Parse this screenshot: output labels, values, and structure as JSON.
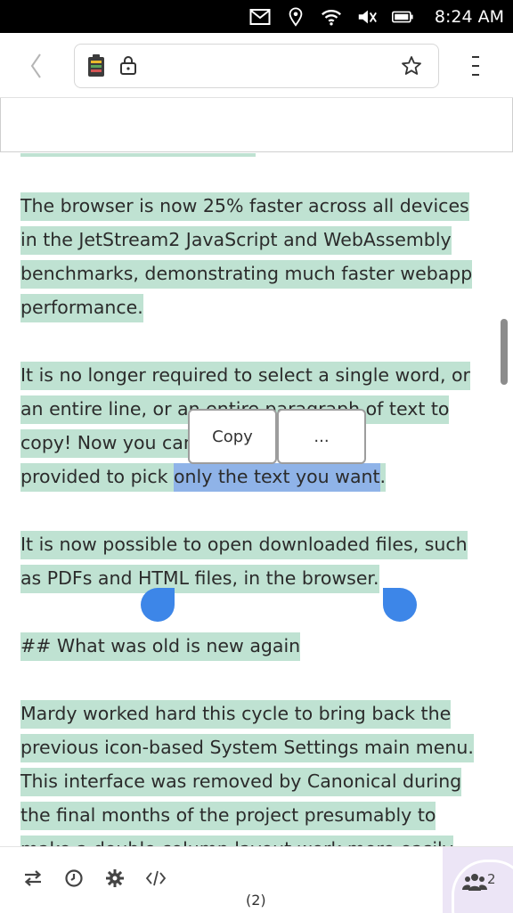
{
  "status": {
    "time": "8:24 AM",
    "icons": [
      "mail-icon",
      "location-icon",
      "wifi-icon",
      "volume-muted-icon",
      "battery-icon"
    ]
  },
  "header": {
    "back_icon": "chevron-left-icon",
    "site_icon": "app-icon",
    "lock_icon": "lock-icon",
    "bookmark_icon": "star-icon",
    "menu_icon": "kebab-menu-icon"
  },
  "content": {
    "paragraph1": "The browser is now 25% faster across all devices in the JetStream2 JavaScript and WebAssembly benchmarks, demonstrating much faster webapp performance.",
    "paragraph2_line1": "It is no longer required to select a single word, or",
    "paragraph2_line2": "an entire line, or an entire paragraph of text to",
    "paragraph2_line3": "copy! Now you can use the handles",
    "paragraph2_line4_plain": "provided to pick ",
    "paragraph2_line4_selected": "only the text you want",
    "paragraph2_line4_end": ".",
    "paragraph3": "It is now possible to open downloaded files, such as PDFs and HTML files, in the browser.",
    "heading": "## What was old is new again",
    "paragraph4": "Mardy worked hard this cycle to bring back the previous icon-based System Settings main menu. This interface was removed by Canonical during the final months of the project presumably to make a double column layout work more easily"
  },
  "popup": {
    "copy_label": "Copy",
    "more_label": "..."
  },
  "toolbar": {
    "tab_count": "(2)",
    "users_count": "2",
    "icons": [
      "swap-arrows-icon",
      "history-clock-icon",
      "settings-gear-icon",
      "code-brackets-icon",
      "users-icon"
    ]
  },
  "colors": {
    "highlight": "#bfe2d2",
    "selection": "#8fb3e8",
    "handle": "#3d86e8"
  }
}
